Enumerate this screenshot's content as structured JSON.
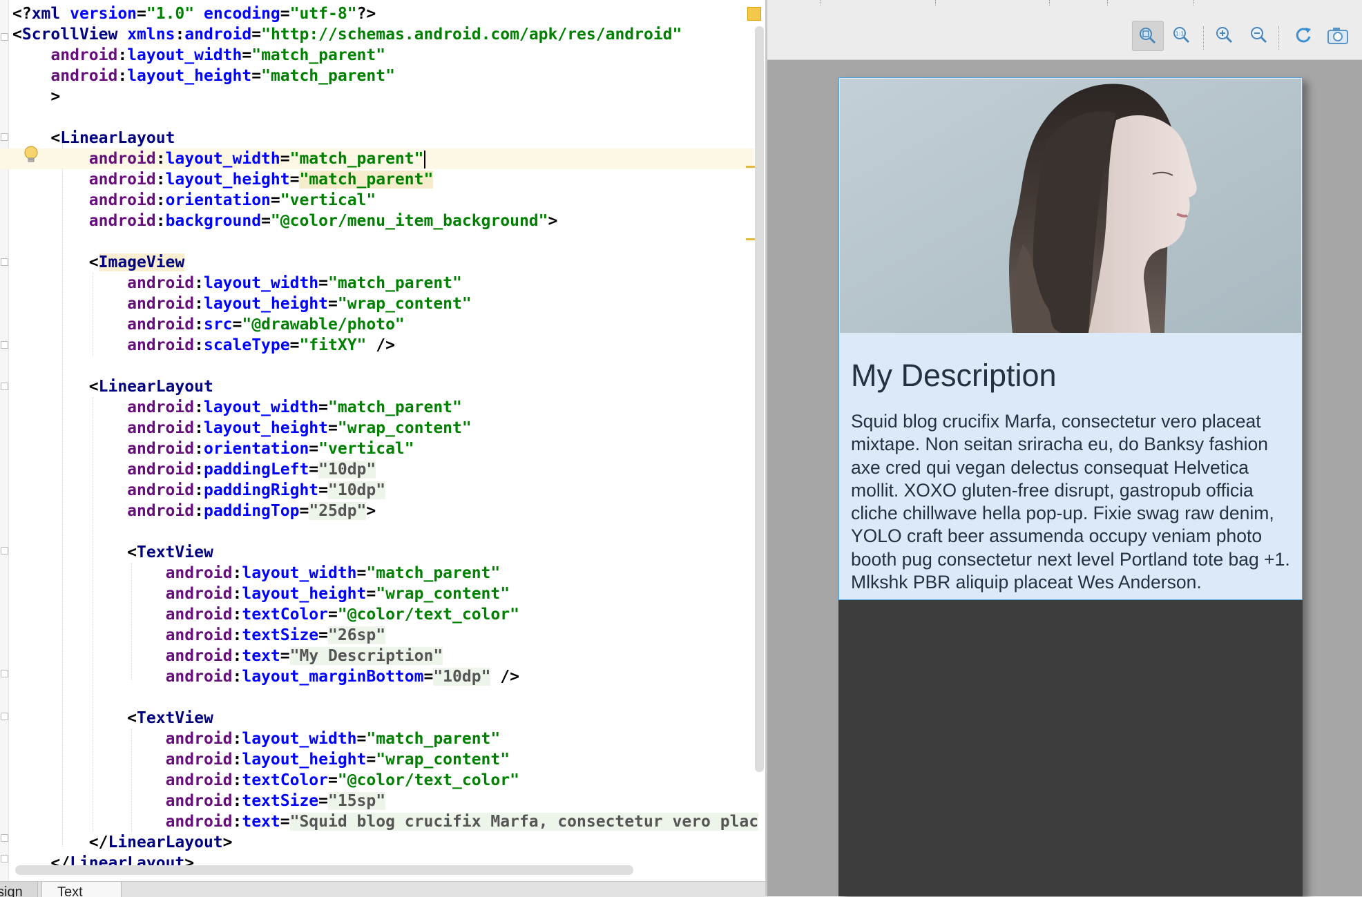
{
  "editor": {
    "lines": [
      [
        [
          "punc",
          "<?"
        ],
        [
          "tag",
          "xml "
        ],
        [
          "attr",
          "version"
        ],
        [
          "punc",
          "="
        ],
        [
          "val",
          "\"1.0\""
        ],
        [
          "punc",
          " "
        ],
        [
          "attr",
          "encoding"
        ],
        [
          "punc",
          "="
        ],
        [
          "val",
          "\"utf-8\""
        ],
        [
          "punc",
          "?>"
        ]
      ],
      [
        [
          "punc",
          "<"
        ],
        [
          "tag",
          "ScrollView "
        ],
        [
          "attr",
          "xmlns"
        ],
        [
          "punc",
          ":"
        ],
        [
          "attr",
          "android"
        ],
        [
          "punc",
          "="
        ],
        [
          "val",
          "\"http://schemas.android.com/apk/res/android\""
        ]
      ],
      [
        [
          "punc",
          "    "
        ],
        [
          "ns",
          "android"
        ],
        [
          "punc",
          ":"
        ],
        [
          "attr",
          "layout_width"
        ],
        [
          "punc",
          "="
        ],
        [
          "val",
          "\"match_parent\""
        ]
      ],
      [
        [
          "punc",
          "    "
        ],
        [
          "ns",
          "android"
        ],
        [
          "punc",
          ":"
        ],
        [
          "attr",
          "layout_height"
        ],
        [
          "punc",
          "="
        ],
        [
          "val",
          "\"match_parent\""
        ]
      ],
      [
        [
          "punc",
          "    >"
        ]
      ],
      [
        [
          "punc",
          ""
        ]
      ],
      [
        [
          "punc",
          "    <"
        ],
        [
          "tag",
          "LinearLayout"
        ]
      ],
      [
        [
          "punc",
          "        "
        ],
        [
          "ns",
          "android"
        ],
        [
          "punc",
          ":"
        ],
        [
          "attr",
          "layout_width"
        ],
        [
          "punc",
          "="
        ],
        [
          "val",
          "\"match_parent\""
        ]
      ],
      [
        [
          "punc",
          "        "
        ],
        [
          "ns",
          "android"
        ],
        [
          "punc",
          ":"
        ],
        [
          "attr",
          "layout_height"
        ],
        [
          "punc",
          "="
        ],
        [
          "val",
          "\"match_parent\""
        ]
      ],
      [
        [
          "punc",
          "        "
        ],
        [
          "ns",
          "android"
        ],
        [
          "punc",
          ":"
        ],
        [
          "attr",
          "orientation"
        ],
        [
          "punc",
          "="
        ],
        [
          "val",
          "\"vertical\""
        ]
      ],
      [
        [
          "punc",
          "        "
        ],
        [
          "ns",
          "android"
        ],
        [
          "punc",
          ":"
        ],
        [
          "attr",
          "background"
        ],
        [
          "punc",
          "="
        ],
        [
          "val",
          "\"@color/menu_item_background\""
        ],
        [
          "punc",
          ">"
        ]
      ],
      [
        [
          "punc",
          ""
        ]
      ],
      [
        [
          "punc",
          "        <"
        ],
        [
          "tag",
          "ImageView"
        ]
      ],
      [
        [
          "punc",
          "            "
        ],
        [
          "ns",
          "android"
        ],
        [
          "punc",
          ":"
        ],
        [
          "attr",
          "layout_width"
        ],
        [
          "punc",
          "="
        ],
        [
          "val",
          "\"match_parent\""
        ]
      ],
      [
        [
          "punc",
          "            "
        ],
        [
          "ns",
          "android"
        ],
        [
          "punc",
          ":"
        ],
        [
          "attr",
          "layout_height"
        ],
        [
          "punc",
          "="
        ],
        [
          "val",
          "\"wrap_content\""
        ]
      ],
      [
        [
          "punc",
          "            "
        ],
        [
          "ns",
          "android"
        ],
        [
          "punc",
          ":"
        ],
        [
          "attr",
          "src"
        ],
        [
          "punc",
          "="
        ],
        [
          "val",
          "\"@drawable/photo\""
        ]
      ],
      [
        [
          "punc",
          "            "
        ],
        [
          "ns",
          "android"
        ],
        [
          "punc",
          ":"
        ],
        [
          "attr",
          "scaleType"
        ],
        [
          "punc",
          "="
        ],
        [
          "val",
          "\"fitXY\""
        ],
        [
          "punc",
          " />"
        ]
      ],
      [
        [
          "punc",
          ""
        ]
      ],
      [
        [
          "punc",
          "        <"
        ],
        [
          "tag",
          "LinearLayout"
        ]
      ],
      [
        [
          "punc",
          "            "
        ],
        [
          "ns",
          "android"
        ],
        [
          "punc",
          ":"
        ],
        [
          "attr",
          "layout_width"
        ],
        [
          "punc",
          "="
        ],
        [
          "val",
          "\"match_parent\""
        ]
      ],
      [
        [
          "punc",
          "            "
        ],
        [
          "ns",
          "android"
        ],
        [
          "punc",
          ":"
        ],
        [
          "attr",
          "layout_height"
        ],
        [
          "punc",
          "="
        ],
        [
          "val",
          "\"wrap_content\""
        ]
      ],
      [
        [
          "punc",
          "            "
        ],
        [
          "ns",
          "android"
        ],
        [
          "punc",
          ":"
        ],
        [
          "attr",
          "orientation"
        ],
        [
          "punc",
          "="
        ],
        [
          "val",
          "\"vertical\""
        ]
      ],
      [
        [
          "punc",
          "            "
        ],
        [
          "ns",
          "android"
        ],
        [
          "punc",
          ":"
        ],
        [
          "attr",
          "paddingLeft"
        ],
        [
          "punc",
          "="
        ],
        [
          "valg",
          "\"10dp\""
        ]
      ],
      [
        [
          "punc",
          "            "
        ],
        [
          "ns",
          "android"
        ],
        [
          "punc",
          ":"
        ],
        [
          "attr",
          "paddingRight"
        ],
        [
          "punc",
          "="
        ],
        [
          "valg",
          "\"10dp\""
        ]
      ],
      [
        [
          "punc",
          "            "
        ],
        [
          "ns",
          "android"
        ],
        [
          "punc",
          ":"
        ],
        [
          "attr",
          "paddingTop"
        ],
        [
          "punc",
          "="
        ],
        [
          "valg",
          "\"25dp\""
        ],
        [
          "punc",
          ">"
        ]
      ],
      [
        [
          "punc",
          ""
        ]
      ],
      [
        [
          "punc",
          "            <"
        ],
        [
          "tag",
          "TextView"
        ]
      ],
      [
        [
          "punc",
          "                "
        ],
        [
          "ns",
          "android"
        ],
        [
          "punc",
          ":"
        ],
        [
          "attr",
          "layout_width"
        ],
        [
          "punc",
          "="
        ],
        [
          "val",
          "\"match_parent\""
        ]
      ],
      [
        [
          "punc",
          "                "
        ],
        [
          "ns",
          "android"
        ],
        [
          "punc",
          ":"
        ],
        [
          "attr",
          "layout_height"
        ],
        [
          "punc",
          "="
        ],
        [
          "val",
          "\"wrap_content\""
        ]
      ],
      [
        [
          "punc",
          "                "
        ],
        [
          "ns",
          "android"
        ],
        [
          "punc",
          ":"
        ],
        [
          "attr",
          "textColor"
        ],
        [
          "punc",
          "="
        ],
        [
          "val",
          "\"@color/text_color\""
        ]
      ],
      [
        [
          "punc",
          "                "
        ],
        [
          "ns",
          "android"
        ],
        [
          "punc",
          ":"
        ],
        [
          "attr",
          "textSize"
        ],
        [
          "punc",
          "="
        ],
        [
          "valg",
          "\"26sp\""
        ]
      ],
      [
        [
          "punc",
          "                "
        ],
        [
          "ns",
          "android"
        ],
        [
          "punc",
          ":"
        ],
        [
          "attr",
          "text"
        ],
        [
          "punc",
          "="
        ],
        [
          "valg",
          "\"My Description\""
        ]
      ],
      [
        [
          "punc",
          "                "
        ],
        [
          "ns",
          "android"
        ],
        [
          "punc",
          ":"
        ],
        [
          "attr",
          "layout_marginBottom"
        ],
        [
          "punc",
          "="
        ],
        [
          "valg",
          "\"10dp\""
        ],
        [
          "punc",
          " />"
        ]
      ],
      [
        [
          "punc",
          ""
        ]
      ],
      [
        [
          "punc",
          "            <"
        ],
        [
          "tag",
          "TextView"
        ]
      ],
      [
        [
          "punc",
          "                "
        ],
        [
          "ns",
          "android"
        ],
        [
          "punc",
          ":"
        ],
        [
          "attr",
          "layout_width"
        ],
        [
          "punc",
          "="
        ],
        [
          "val",
          "\"match_parent\""
        ]
      ],
      [
        [
          "punc",
          "                "
        ],
        [
          "ns",
          "android"
        ],
        [
          "punc",
          ":"
        ],
        [
          "attr",
          "layout_height"
        ],
        [
          "punc",
          "="
        ],
        [
          "val",
          "\"wrap_content\""
        ]
      ],
      [
        [
          "punc",
          "                "
        ],
        [
          "ns",
          "android"
        ],
        [
          "punc",
          ":"
        ],
        [
          "attr",
          "textColor"
        ],
        [
          "punc",
          "="
        ],
        [
          "val",
          "\"@color/text_color\""
        ]
      ],
      [
        [
          "punc",
          "                "
        ],
        [
          "ns",
          "android"
        ],
        [
          "punc",
          ":"
        ],
        [
          "attr",
          "textSize"
        ],
        [
          "punc",
          "="
        ],
        [
          "valg",
          "\"15sp\""
        ]
      ],
      [
        [
          "punc",
          "                "
        ],
        [
          "ns",
          "android"
        ],
        [
          "punc",
          ":"
        ],
        [
          "attr",
          "text"
        ],
        [
          "punc",
          "="
        ],
        [
          "valg",
          "\"Squid blog crucifix Marfa, consectetur vero plac"
        ]
      ],
      [
        [
          "punc",
          "        </"
        ],
        [
          "tag",
          "LinearLayout"
        ],
        [
          "punc",
          ">"
        ]
      ],
      [
        [
          "punc",
          "    </"
        ],
        [
          "tag",
          "LinearLayout"
        ],
        [
          "punc",
          ">"
        ]
      ]
    ],
    "active_line": 7
  },
  "tabs": {
    "design": "sign",
    "text": "Text"
  },
  "toolbar": {
    "icons": [
      "zoom-to-fit-icon",
      "actual-size-icon",
      "zoom-in-icon",
      "zoom-out-icon",
      "refresh-icon",
      "screenshot-icon"
    ]
  },
  "preview": {
    "title": "My Description",
    "body": "Squid blog crucifix Marfa, consectetur vero placeat mixtape. Non seitan sriracha eu, do Banksy fashion axe cred qui vegan delectus consequat Helvetica mollit. XOXO gluten-free disrupt, gastropub officia cliche chillwave hella pop-up. Fixie swag raw denim, YOLO craft beer assumenda occupy veniam photo booth pug consectetur next level Portland tote bag +1. Mlkshk PBR aliquip placeat Wes Anderson."
  },
  "colors": {
    "tag": "#000080",
    "namespace": "#660e7a",
    "attribute": "#0000ff",
    "value": "#008000",
    "layout_background": "#dbeaf6",
    "text_color": "#22323f",
    "device_background": "#3d3d3d"
  }
}
